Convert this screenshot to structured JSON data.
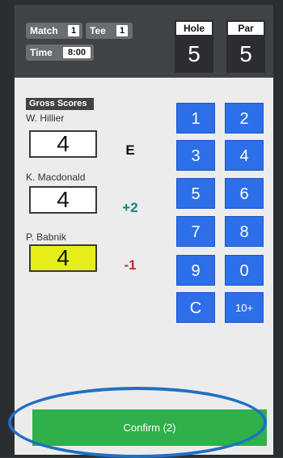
{
  "header": {
    "match_label": "Match",
    "match_value": "1",
    "tee_label": "Tee",
    "tee_value": "1",
    "time_label": "Time",
    "time_value": "8:00",
    "hole_label": "Hole",
    "hole_value": "5",
    "par_label": "Par",
    "par_value": "5"
  },
  "scores": {
    "section_title": "Gross Scores",
    "players": [
      {
        "name": "W. Hillier",
        "score": "4",
        "to_par": "E",
        "to_par_color": "#111111"
      },
      {
        "name": "K. Macdonald",
        "score": "4",
        "to_par": "+2",
        "to_par_color": "#1a7f86"
      },
      {
        "name": "P. Babnik",
        "score": "4",
        "to_par": "-1",
        "to_par_color": "#c62828"
      }
    ]
  },
  "keypad": {
    "keys": [
      "1",
      "2",
      "3",
      "4",
      "5",
      "6",
      "7",
      "8",
      "9",
      "0",
      "C",
      "10+"
    ]
  },
  "confirm": {
    "label": "Confirm (2)"
  },
  "colors": {
    "keypad": "#2d6fe8",
    "confirm": "#2fb04a",
    "active_score": "#e6ee1a",
    "header_bg": "#404346",
    "ring": "#1f6fc5"
  }
}
